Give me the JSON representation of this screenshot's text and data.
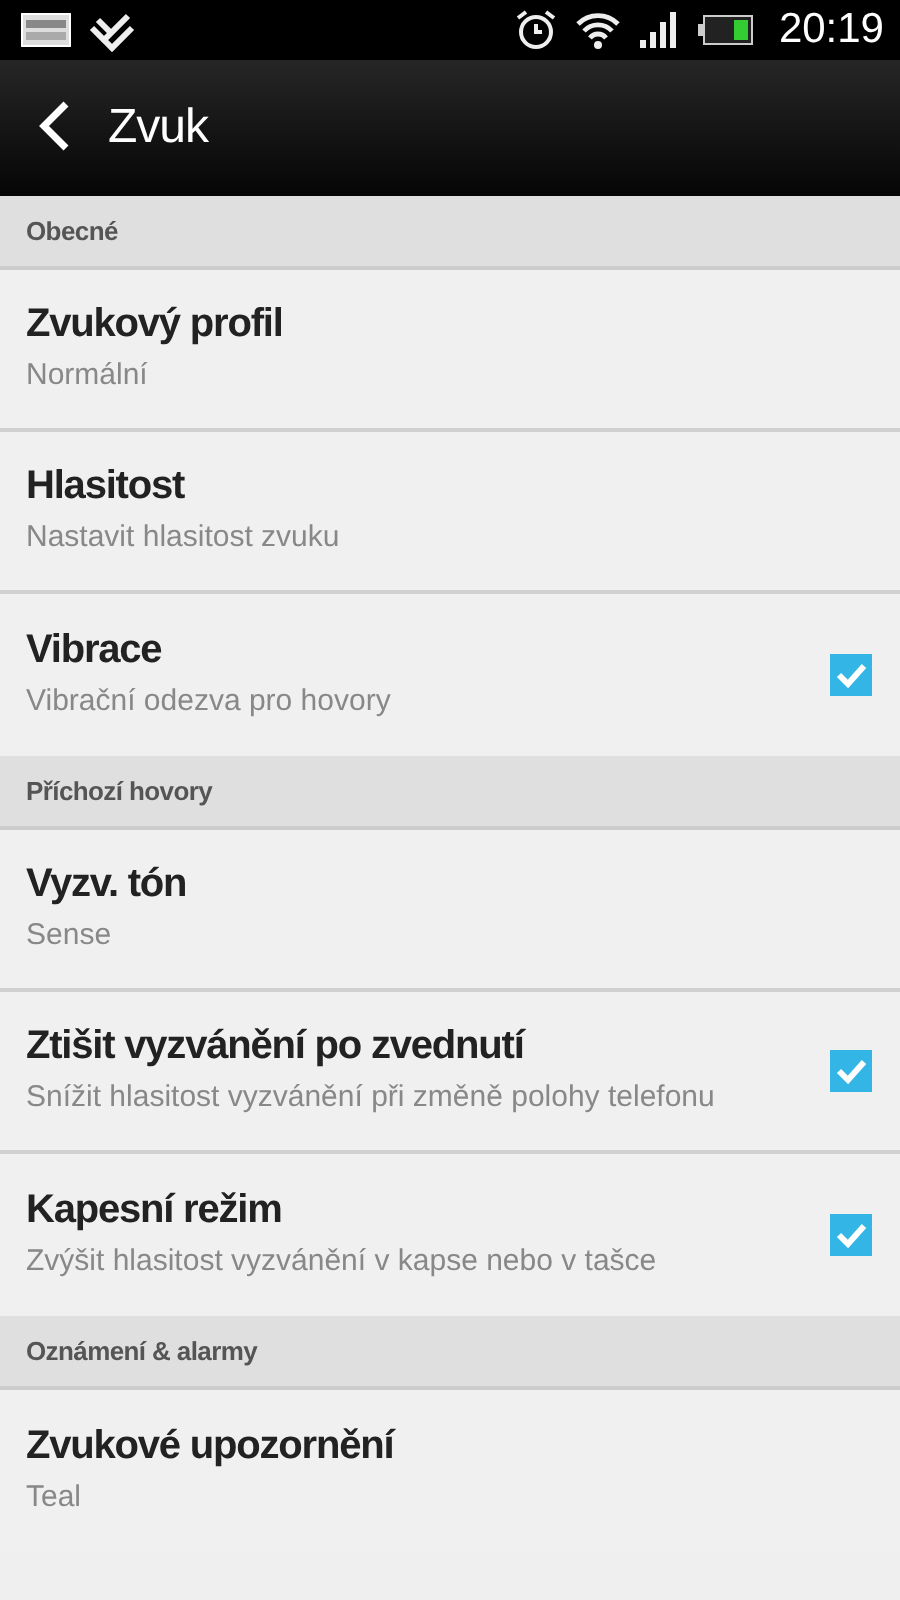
{
  "status_bar": {
    "time": "20:19"
  },
  "app_bar": {
    "title": "Zvuk"
  },
  "sections": [
    {
      "title": "Obecné",
      "items": [
        {
          "kind": "plain",
          "title": "Zvukový profil",
          "summary": "Normální"
        },
        {
          "kind": "plain",
          "title": "Hlasitost",
          "summary": "Nastavit hlasitost zvuku"
        },
        {
          "kind": "checkbox",
          "title": "Vibrace",
          "summary": "Vibrační odezva pro hovory",
          "checked": true
        }
      ]
    },
    {
      "title": "Příchozí hovory",
      "items": [
        {
          "kind": "plain",
          "title": "Vyzv. tón",
          "summary": "Sense"
        },
        {
          "kind": "checkbox",
          "title": "Ztišit vyzvánění po zvednutí",
          "summary": "Snížit hlasitost vyzvánění při změně polohy telefonu",
          "checked": true
        },
        {
          "kind": "checkbox",
          "title": "Kapesní režim",
          "summary": "Zvýšit hlasitost vyzvánění v kapse nebo v tašce",
          "checked": true
        }
      ]
    },
    {
      "title": "Oznámení & alarmy",
      "items": [
        {
          "kind": "plain",
          "title": "Zvukové upozornění",
          "summary": "Teal"
        }
      ]
    }
  ]
}
